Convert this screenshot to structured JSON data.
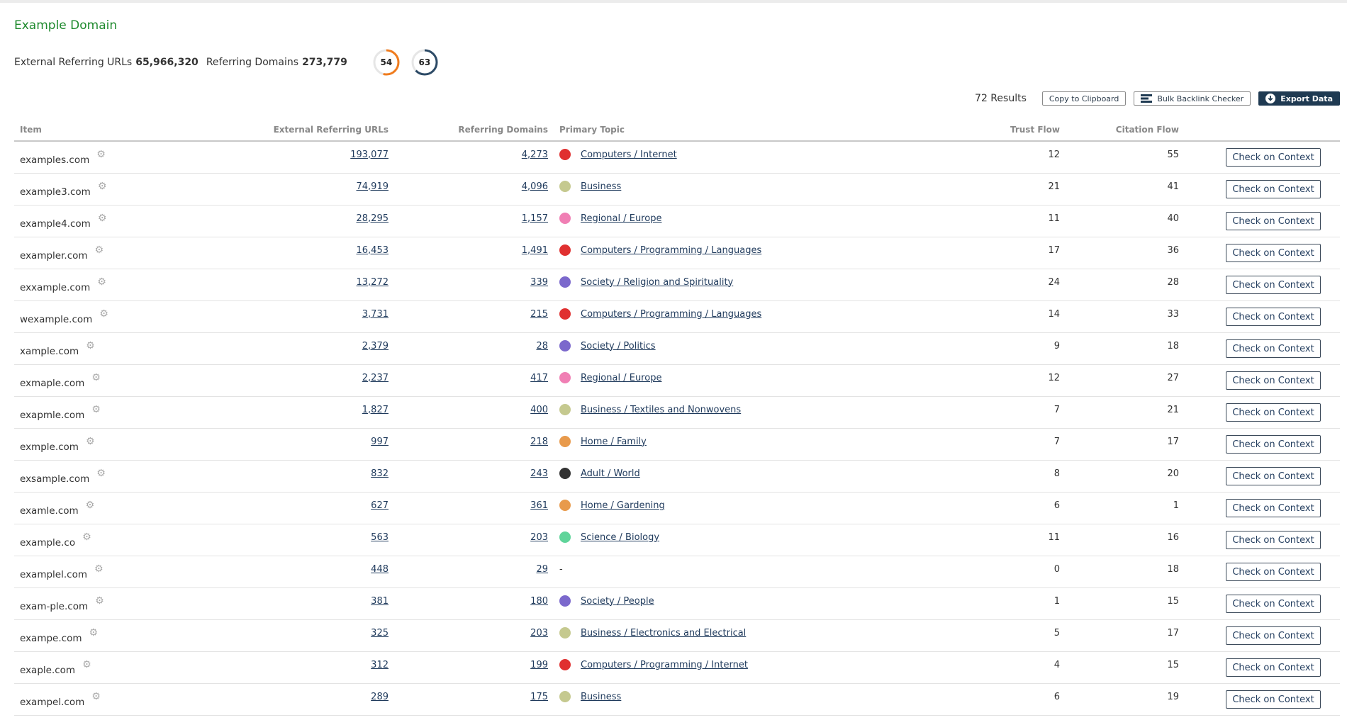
{
  "page": {
    "title": "Example Domain"
  },
  "summary": {
    "ext_urls_label": "External Referring URLs",
    "ext_urls_value": "65,966,320",
    "ref_domains_label": "Referring Domains",
    "ref_domains_value": "273,779",
    "gauges": [
      {
        "name": "trust-flow",
        "value": "54",
        "fraction": 0.54,
        "color": "#f07c1e"
      },
      {
        "name": "citation-flow",
        "value": "63",
        "fraction": 0.63,
        "color": "#2c4a66"
      }
    ]
  },
  "toolbar": {
    "results": "72 Results",
    "copy_label": "Copy to Clipboard",
    "bulk_label": "Bulk Backlink Checker",
    "export_label": "Export Data",
    "bulk_icon": "list-icon",
    "export_icon": "download-icon"
  },
  "table": {
    "headers": {
      "item": "Item",
      "ext_urls": "External Referring URLs",
      "ref_domains": "Referring Domains",
      "topic": "Primary Topic",
      "trust_flow": "Trust Flow",
      "citation_flow": "Citation Flow"
    },
    "button_label": "Check on Context",
    "rows": [
      {
        "item": "examples.com",
        "ext_urls": "193,077",
        "ref_domains": "4,273",
        "topic": "Computers / Internet",
        "topic_color": "#e03030",
        "trust_flow": "12",
        "citation_flow": "55"
      },
      {
        "item": "example3.com",
        "ext_urls": "74,919",
        "ref_domains": "4,096",
        "topic": "Business",
        "topic_color": "#c5c98f",
        "trust_flow": "21",
        "citation_flow": "41"
      },
      {
        "item": "example4.com",
        "ext_urls": "28,295",
        "ref_domains": "1,157",
        "topic": "Regional / Europe",
        "topic_color": "#f07fb4",
        "trust_flow": "11",
        "citation_flow": "40"
      },
      {
        "item": "exampler.com",
        "ext_urls": "16,453",
        "ref_domains": "1,491",
        "topic": "Computers / Programming / Languages",
        "topic_color": "#e03030",
        "trust_flow": "17",
        "citation_flow": "36"
      },
      {
        "item": "exxample.com",
        "ext_urls": "13,272",
        "ref_domains": "339",
        "topic": "Society / Religion and Spirituality",
        "topic_color": "#7b68cc",
        "trust_flow": "24",
        "citation_flow": "28"
      },
      {
        "item": "wexample.com",
        "ext_urls": "3,731",
        "ref_domains": "215",
        "topic": "Computers / Programming / Languages",
        "topic_color": "#e03030",
        "trust_flow": "14",
        "citation_flow": "33"
      },
      {
        "item": "xample.com",
        "ext_urls": "2,379",
        "ref_domains": "28",
        "topic": "Society / Politics",
        "topic_color": "#7b68cc",
        "trust_flow": "9",
        "citation_flow": "18"
      },
      {
        "item": "exmaple.com",
        "ext_urls": "2,237",
        "ref_domains": "417",
        "topic": "Regional / Europe",
        "topic_color": "#f07fb4",
        "trust_flow": "12",
        "citation_flow": "27"
      },
      {
        "item": "exapmle.com",
        "ext_urls": "1,827",
        "ref_domains": "400",
        "topic": "Business / Textiles and Nonwovens",
        "topic_color": "#c5c98f",
        "trust_flow": "7",
        "citation_flow": "21"
      },
      {
        "item": "exmple.com",
        "ext_urls": "997",
        "ref_domains": "218",
        "topic": "Home / Family",
        "topic_color": "#e89a4c",
        "trust_flow": "7",
        "citation_flow": "17"
      },
      {
        "item": "exsample.com",
        "ext_urls": "832",
        "ref_domains": "243",
        "topic": "Adult / World",
        "topic_color": "#333333",
        "trust_flow": "8",
        "citation_flow": "20"
      },
      {
        "item": "examle.com",
        "ext_urls": "627",
        "ref_domains": "361",
        "topic": "Home / Gardening",
        "topic_color": "#e89a4c",
        "trust_flow": "6",
        "citation_flow": "1"
      },
      {
        "item": "example.co",
        "ext_urls": "563",
        "ref_domains": "203",
        "topic": "Science / Biology",
        "topic_color": "#5fd49a",
        "trust_flow": "11",
        "citation_flow": "16"
      },
      {
        "item": "examplel.com",
        "ext_urls": "448",
        "ref_domains": "29",
        "topic": "-",
        "topic_color": "",
        "trust_flow": "0",
        "citation_flow": "18"
      },
      {
        "item": "exam-ple.com",
        "ext_urls": "381",
        "ref_domains": "180",
        "topic": "Society / People",
        "topic_color": "#7b68cc",
        "trust_flow": "1",
        "citation_flow": "15"
      },
      {
        "item": "exampe.com",
        "ext_urls": "325",
        "ref_domains": "203",
        "topic": "Business / Electronics and Electrical",
        "topic_color": "#c5c98f",
        "trust_flow": "5",
        "citation_flow": "17"
      },
      {
        "item": "exaple.com",
        "ext_urls": "312",
        "ref_domains": "199",
        "topic": "Computers / Programming / Internet",
        "topic_color": "#e03030",
        "trust_flow": "4",
        "citation_flow": "15"
      },
      {
        "item": "exampel.com",
        "ext_urls": "289",
        "ref_domains": "175",
        "topic": "Business",
        "topic_color": "#c5c98f",
        "trust_flow": "6",
        "citation_flow": "19"
      }
    ]
  }
}
